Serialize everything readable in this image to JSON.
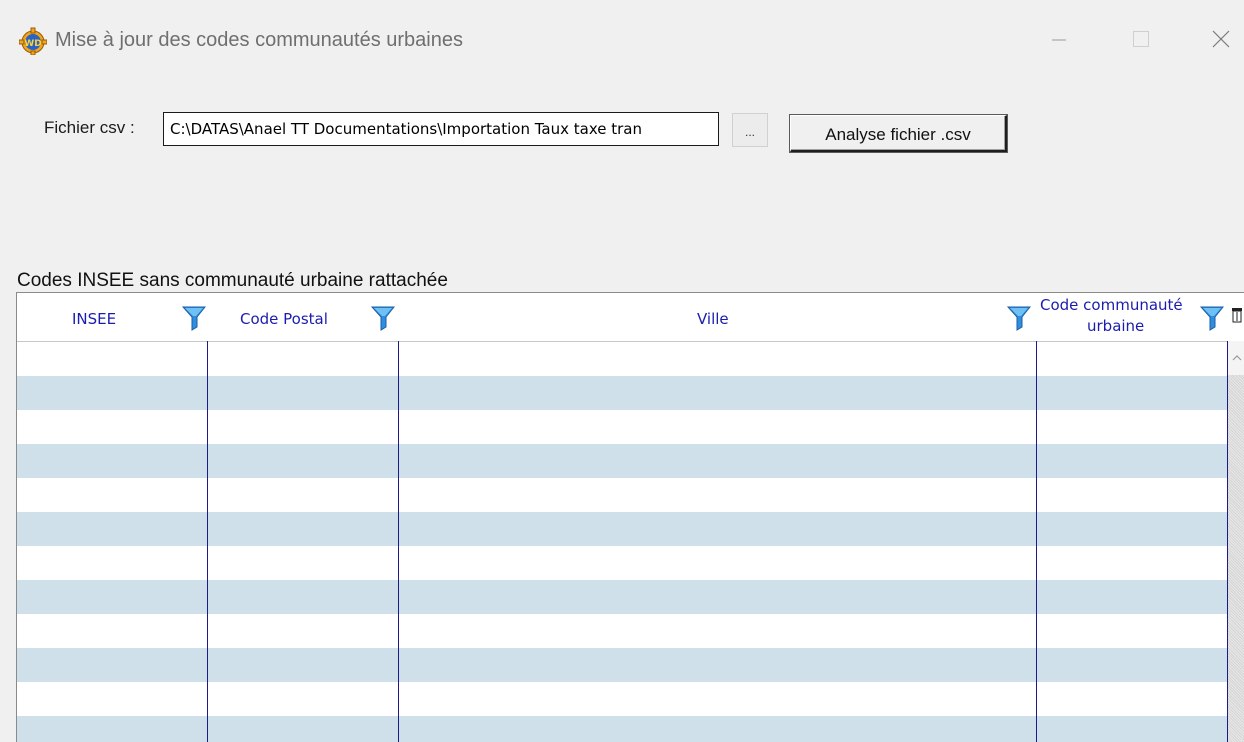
{
  "window": {
    "title": "Mise à jour des codes communautés urbaines",
    "icon": "windev-gear-icon",
    "controls": [
      "minimize-icon",
      "maximize-icon",
      "close-icon"
    ]
  },
  "file_row": {
    "label": "Fichier csv :",
    "path_value": "C:\\DATAS\\Anael TT Documentations\\Importation Taux taxe tran",
    "browse_label": "...",
    "analyse_button": "Analyse fichier .csv"
  },
  "table": {
    "caption": "Codes INSEE sans communauté urbaine rattachée",
    "columns": [
      {
        "label": "INSEE",
        "filter_icon": "filter-funnel-icon"
      },
      {
        "label": "Code Postal",
        "filter_icon": "filter-funnel-icon"
      },
      {
        "label": "Ville",
        "filter_icon": "filter-funnel-icon"
      },
      {
        "label_line1": "Code communauté",
        "label_line2": "urbaine",
        "filter_icon": "filter-funnel-icon"
      }
    ],
    "rows": [],
    "row_colors": {
      "plain": "#ffffff",
      "alt": "#d0e0ea"
    },
    "header_text_color": "#1c1cae",
    "column_line_color": "#1b1b8c"
  }
}
